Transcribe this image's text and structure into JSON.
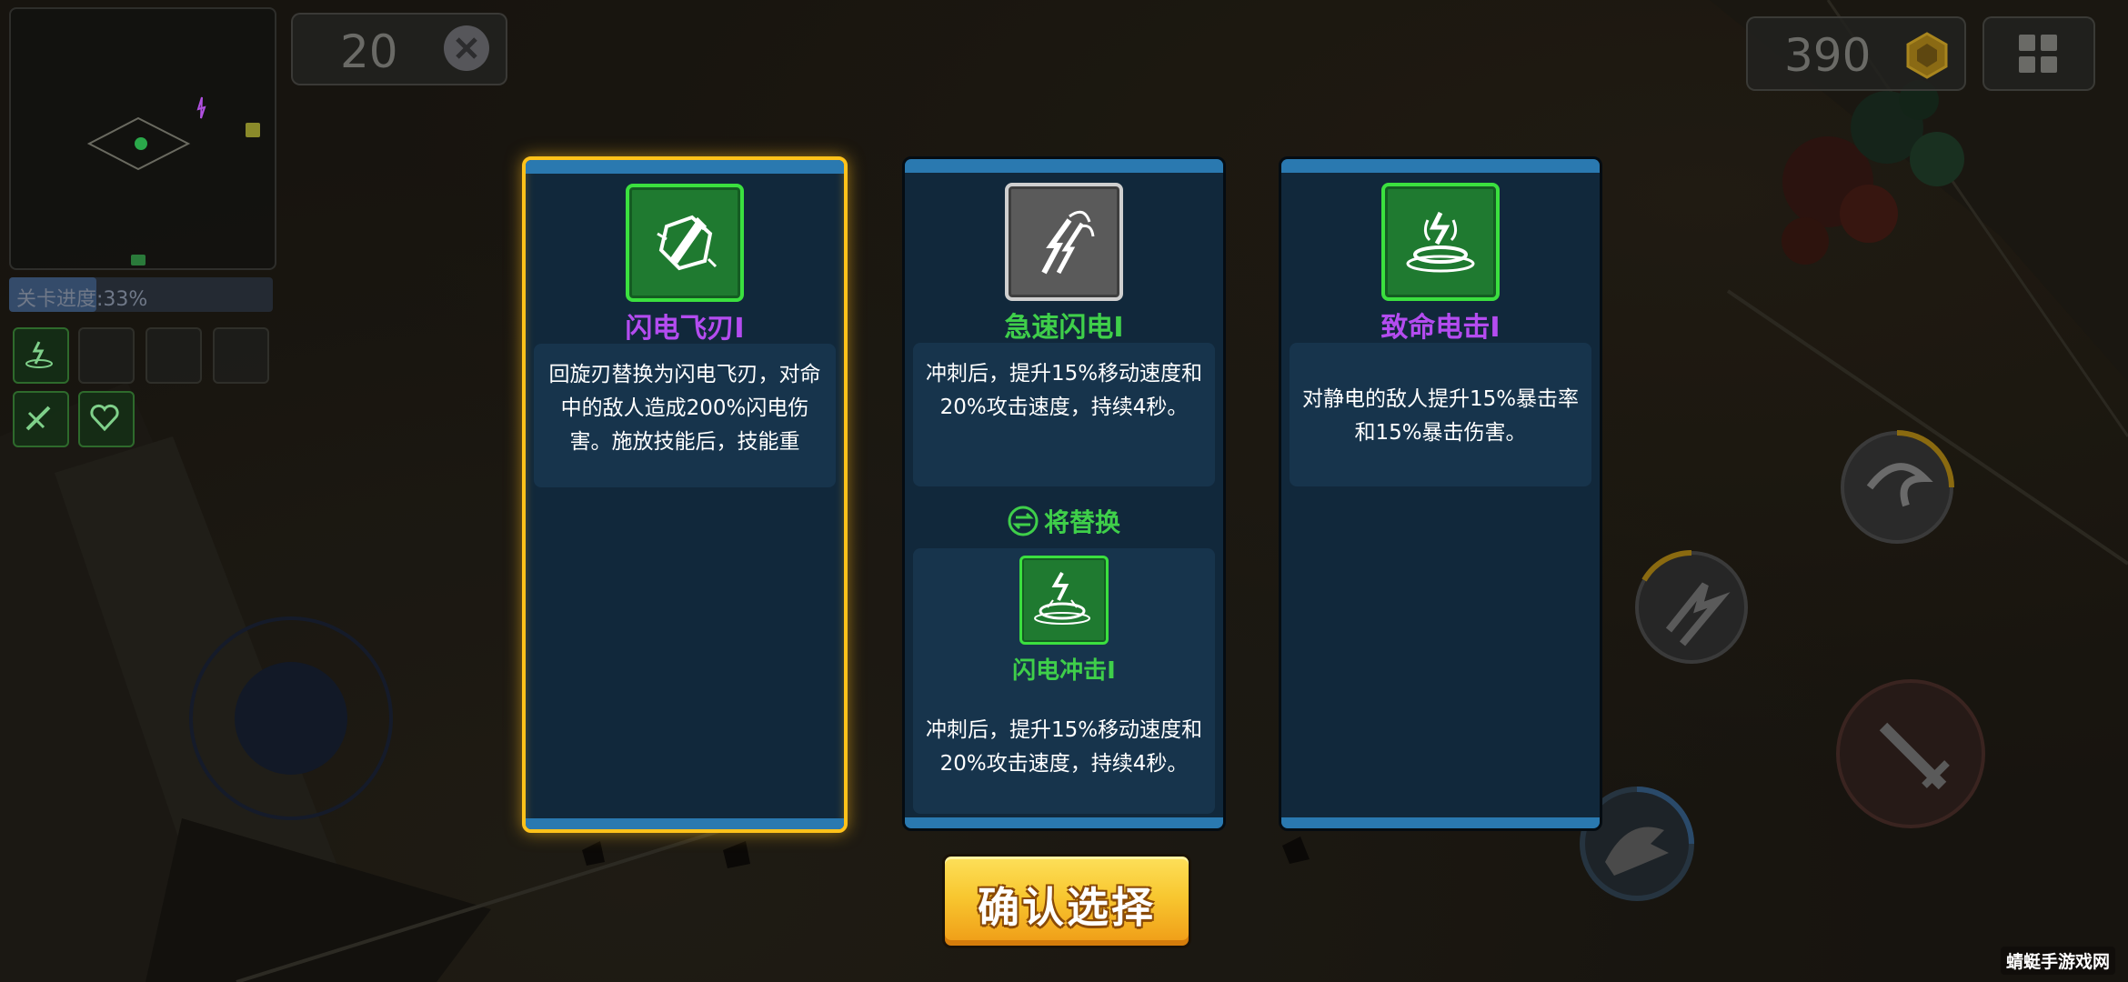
{
  "hud": {
    "kill_count": "20",
    "coin_count": "390",
    "level_progress_text": "关卡进度:33%",
    "level_progress": 0.33,
    "icons": {
      "kill": "skull-icon",
      "coin": "gold-coin-icon",
      "menu": "grid-menu-icon"
    }
  },
  "cards": [
    {
      "name": "闪电飞刃I",
      "name_color": "#b44cf0",
      "icon": "lightning-blade-icon",
      "description": "回旋刃替换为闪电飞刃，对命中的敌人造成200%闪电伤害。施放技能后，技能重",
      "selected": true
    },
    {
      "name": "急速闪电I",
      "name_color": "#3fcf4a",
      "icon": "swift-lightning-icon",
      "description": "冲刺后，提升15%移动速度和20%攻击速度，持续4秒。",
      "replace_label": "将替换",
      "replaced_skill": {
        "name": "闪电冲击I",
        "icon": "lightning-strike-icon",
        "description": "冲刺后，提升15%移动速度和20%攻击速度，持续4秒。"
      },
      "selected": false
    },
    {
      "name": "致命电击I",
      "name_color": "#b44cf0",
      "icon": "static-shock-icon",
      "description": "对静电的敌人提升15%暴击率和15%暴击伤害。",
      "selected": false
    }
  ],
  "confirm_label": "确认选择",
  "watermark": "蜻蜓手游戏网",
  "colors": {
    "selected_border": "#ffc21a",
    "card_bg": "#11283b",
    "card_strip": "#2a79b0",
    "green": "#3fcf4a",
    "purple": "#b44cf0"
  }
}
